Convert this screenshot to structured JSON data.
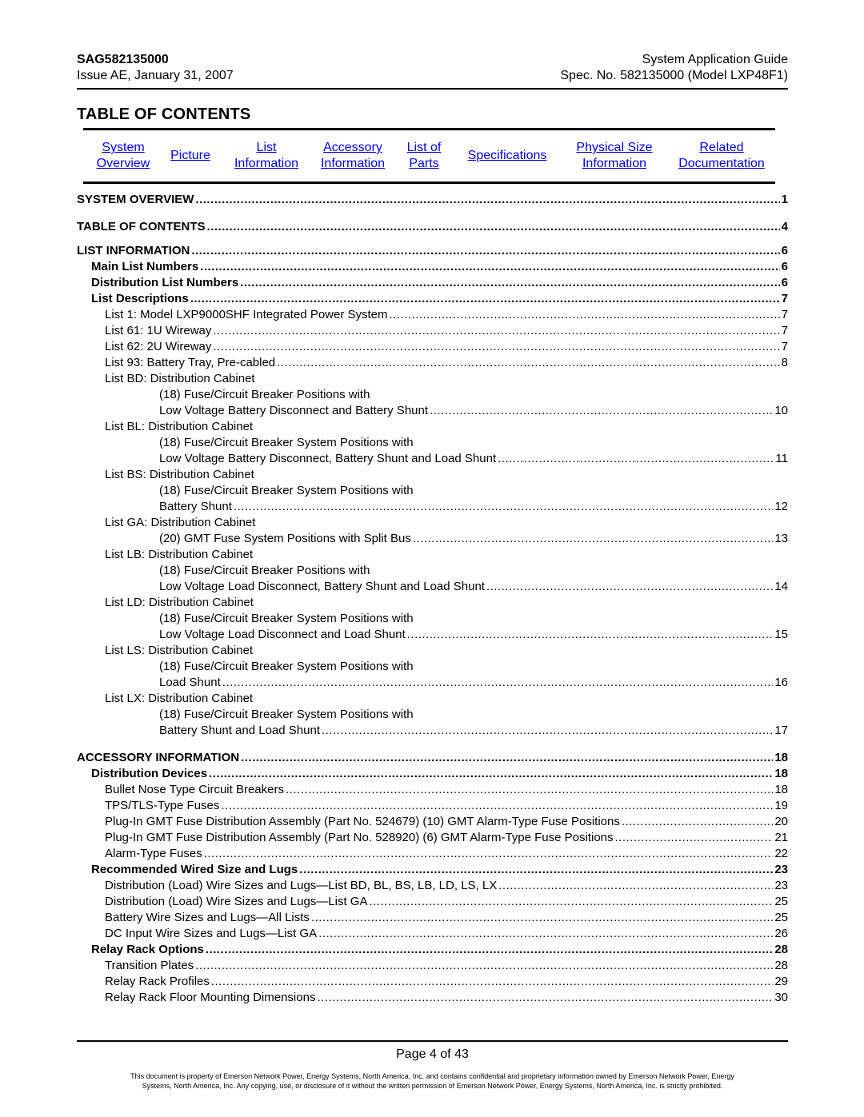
{
  "header": {
    "doc_id": "SAG582135000",
    "issue": "Issue AE, January 31, 2007",
    "guide_title": "System Application Guide",
    "spec": "Spec. No. 582135000 (Model LXP48F1)"
  },
  "title": "TABLE OF CONTENTS",
  "link_color": "#0000ee",
  "nav": [
    {
      "line1": "System",
      "line2": "Overview"
    },
    {
      "line1": "Picture",
      "line2": ""
    },
    {
      "line1": "List",
      "line2": "Information"
    },
    {
      "line1": "Accessory",
      "line2": "Information"
    },
    {
      "line1": "List of",
      "line2": "Parts"
    },
    {
      "line1": "Specifications",
      "line2": ""
    },
    {
      "line1": "Physical Size",
      "line2": "Information"
    },
    {
      "line1": "Related",
      "line2": "Documentation"
    }
  ],
  "toc": [
    {
      "text": "SYSTEM OVERVIEW",
      "page": "1",
      "level": "b1"
    },
    {
      "text": "TABLE OF CONTENTS",
      "page": "4",
      "level": "b1"
    },
    {
      "text": "LIST INFORMATION",
      "page": "6",
      "level": "b1"
    },
    {
      "text": "Main List Numbers",
      "page": "6",
      "level": "b2"
    },
    {
      "text": "Distribution List Numbers",
      "page": "6",
      "level": "b2"
    },
    {
      "text": "List Descriptions",
      "page": "7",
      "level": "b2"
    },
    {
      "text": "List 1:  Model LXP9000SHF Integrated Power System",
      "page": "7",
      "level": "n3"
    },
    {
      "text": "List 61:  1U Wireway",
      "page": "7",
      "level": "n3"
    },
    {
      "text": "List 62:  2U Wireway",
      "page": "7",
      "level": "n3"
    },
    {
      "text": "List 93:  Battery Tray, Pre-cabled",
      "page": "8",
      "level": "n3"
    },
    {
      "text": "List BD:  Distribution Cabinet",
      "page": "",
      "level": "n3 plain"
    },
    {
      "text": "(18) Fuse/Circuit Breaker Positions with",
      "page": "",
      "level": "n4 plain"
    },
    {
      "text": "Low Voltage Battery Disconnect and Battery Shunt",
      "page": "10",
      "level": "n4"
    },
    {
      "text": "List BL:  Distribution Cabinet",
      "page": "",
      "level": "n3 plain"
    },
    {
      "text": "(18) Fuse/Circuit Breaker System Positions with",
      "page": "",
      "level": "n4 plain"
    },
    {
      "text": "Low Voltage Battery Disconnect, Battery Shunt and Load Shunt",
      "page": "11",
      "level": "n4"
    },
    {
      "text": "List BS:  Distribution Cabinet",
      "page": "",
      "level": "n3 plain"
    },
    {
      "text": "(18) Fuse/Circuit Breaker System Positions with",
      "page": "",
      "level": "n4 plain"
    },
    {
      "text": "Battery Shunt",
      "page": "12",
      "level": "n4"
    },
    {
      "text": "List GA:  Distribution Cabinet",
      "page": "",
      "level": "n3 plain"
    },
    {
      "text": "(20) GMT Fuse System Positions with Split Bus",
      "page": "13",
      "level": "n4"
    },
    {
      "text": "List LB:  Distribution Cabinet",
      "page": "",
      "level": "n3 plain"
    },
    {
      "text": "(18) Fuse/Circuit Breaker Positions with",
      "page": "",
      "level": "n4 plain"
    },
    {
      "text": "Low Voltage Load Disconnect, Battery Shunt and Load Shunt",
      "page": "14",
      "level": "n4"
    },
    {
      "text": "List LD:  Distribution Cabinet",
      "page": "",
      "level": "n3 plain"
    },
    {
      "text": "(18) Fuse/Circuit Breaker System Positions with",
      "page": "",
      "level": "n4 plain"
    },
    {
      "text": "Low Voltage Load Disconnect and Load Shunt",
      "page": "15",
      "level": "n4"
    },
    {
      "text": "List LS:  Distribution Cabinet",
      "page": "",
      "level": "n3 plain"
    },
    {
      "text": "(18) Fuse/Circuit Breaker System Positions with",
      "page": "",
      "level": "n4 plain"
    },
    {
      "text": "Load Shunt",
      "page": "16",
      "level": "n4"
    },
    {
      "text": "List LX:  Distribution Cabinet",
      "page": "",
      "level": "n3 plain"
    },
    {
      "text": "(18) Fuse/Circuit Breaker System Positions with",
      "page": "",
      "level": "n4 plain"
    },
    {
      "text": "Battery Shunt and Load Shunt",
      "page": "17",
      "level": "n4"
    },
    {
      "text": "ACCESSORY INFORMATION",
      "page": "18",
      "level": "b1"
    },
    {
      "text": "Distribution Devices",
      "page": "18",
      "level": "b2"
    },
    {
      "text": "Bullet Nose Type Circuit Breakers",
      "page": "18",
      "level": "n3"
    },
    {
      "text": "TPS/TLS-Type Fuses",
      "page": "19",
      "level": "n3"
    },
    {
      "text": "Plug-In GMT Fuse Distribution Assembly (Part No. 524679) (10) GMT Alarm-Type Fuse Positions",
      "page": "20",
      "level": "n3"
    },
    {
      "text": "Plug-In GMT Fuse Distribution Assembly (Part No. 528920) (6) GMT Alarm-Type Fuse Positions",
      "page": "21",
      "level": "n3"
    },
    {
      "text": "Alarm-Type Fuses",
      "page": "22",
      "level": "n3"
    },
    {
      "text": "Recommended Wired Size and Lugs",
      "page": "23",
      "level": "b2"
    },
    {
      "text": "Distribution (Load) Wire Sizes and Lugs—List BD, BL, BS, LB, LD, LS, LX",
      "page": "23",
      "level": "n3"
    },
    {
      "text": "Distribution (Load) Wire Sizes and Lugs—List GA",
      "page": "25",
      "level": "n3"
    },
    {
      "text": "Battery Wire Sizes and Lugs—All Lists",
      "page": "25",
      "level": "n3"
    },
    {
      "text": "DC Input Wire Sizes and Lugs—List GA",
      "page": "26",
      "level": "n3"
    },
    {
      "text": "Relay Rack Options",
      "page": "28",
      "level": "b2"
    },
    {
      "text": "Transition Plates",
      "page": "28",
      "level": "n3"
    },
    {
      "text": "Relay Rack Profiles",
      "page": "29",
      "level": "n3"
    },
    {
      "text": "Relay Rack Floor Mounting Dimensions",
      "page": "30",
      "level": "n3"
    }
  ],
  "footer": {
    "page_label": "Page 4 of 43",
    "legal_line1": "This document is property of Emerson Network Power, Energy Systems, North America, Inc. and contains confidential and proprietary information owned by Emerson Network Power, Energy",
    "legal_line2": "Systems, North America, Inc.  Any copying, use, or disclosure of it without the written permission of Emerson Network Power, Energy Systems, North America, Inc. is strictly prohibited."
  }
}
